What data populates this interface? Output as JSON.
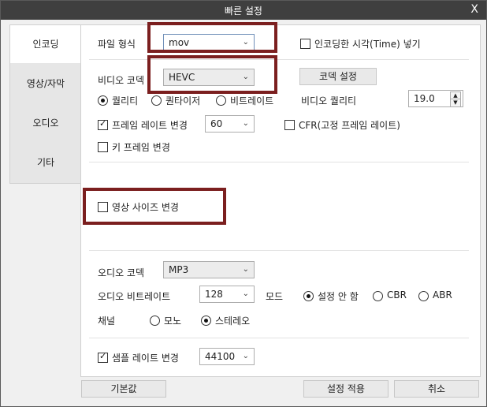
{
  "window": {
    "title": "빠른 설정",
    "close_label": "X"
  },
  "sidebar": {
    "items": [
      {
        "label": "인코딩"
      },
      {
        "label": "영상/자막"
      },
      {
        "label": "오디오"
      },
      {
        "label": "기타"
      }
    ]
  },
  "encoding": {
    "file_format_label": "파일 형식",
    "file_format_value": "mov",
    "insert_time_label": "인코딩한 시각(Time) 넣기",
    "video_codec_label": "비디오 코덱",
    "video_codec_value": "HEVC",
    "codec_settings_button": "코덱 설정",
    "mode_quality": "퀄리티",
    "mode_quantizer": "퀀타이저",
    "mode_bitrate": "비트레이트",
    "video_quality_label": "비디오 퀄리티",
    "video_quality_value": "19.0",
    "change_framerate_label": "프레임 레이트 변경",
    "framerate_value": "60",
    "cfr_label": "CFR(고정 프레임 레이트)",
    "keyframe_label": "키 프레임 변경"
  },
  "video": {
    "change_size_label": "영상 사이즈 변경"
  },
  "audio": {
    "codec_label": "오디오 코덱",
    "codec_value": "MP3",
    "bitrate_label": "오디오 비트레이트",
    "bitrate_value": "128",
    "mode_label": "모드",
    "mode_none": "설정 안 함",
    "mode_cbr": "CBR",
    "mode_abr": "ABR",
    "channel_label": "채널",
    "channel_mono": "모노",
    "channel_stereo": "스테레오",
    "change_samplerate_label": "샘플 레이트 변경",
    "samplerate_value": "44100"
  },
  "footer": {
    "default_button": "기본값",
    "apply_button": "설정 적용",
    "cancel_button": "취소"
  },
  "colors": {
    "highlight": "#7b1f1f",
    "titlebar": "#3f3f3f"
  }
}
